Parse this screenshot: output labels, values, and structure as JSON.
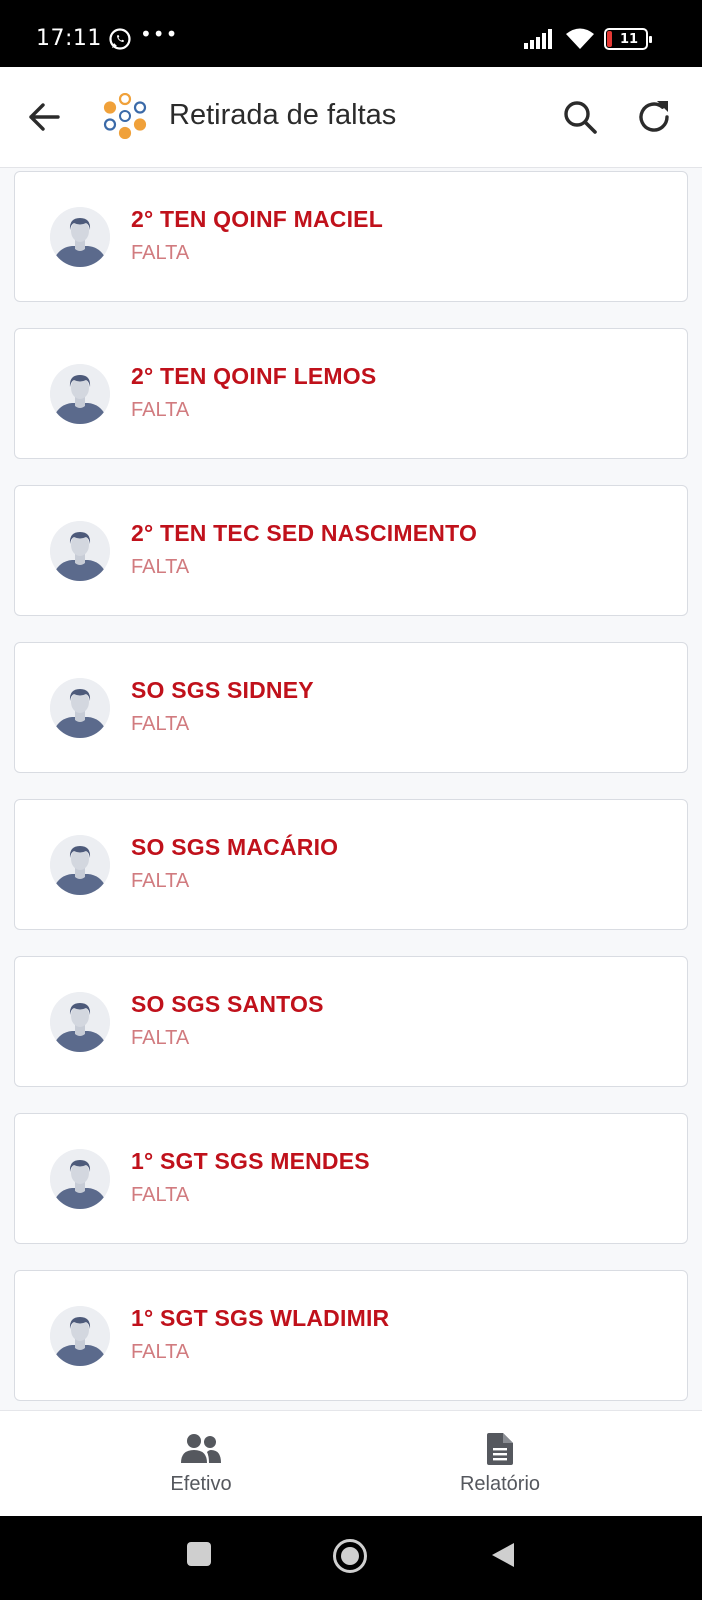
{
  "status_bar": {
    "time": "17:11",
    "more": "•••",
    "battery": "11"
  },
  "app_bar": {
    "title": "Retirada de faltas",
    "icons": [
      "back-arrow-icon",
      "app-logo-icon",
      "search-icon",
      "refresh-icon"
    ]
  },
  "list": {
    "items": [
      {
        "name": "2° TEN QOINF MACIEL",
        "status": "FALTA"
      },
      {
        "name": "2° TEN QOINF LEMOS",
        "status": "FALTA"
      },
      {
        "name": "2° TEN TEC SED NASCIMENTO",
        "status": "FALTA"
      },
      {
        "name": "SO SGS SIDNEY",
        "status": "FALTA"
      },
      {
        "name": "SO SGS MACÁRIO",
        "status": "FALTA"
      },
      {
        "name": "SO SGS SANTOS",
        "status": "FALTA"
      },
      {
        "name": "1° SGT SGS MENDES",
        "status": "FALTA"
      },
      {
        "name": "1° SGT SGS WLADIMIR",
        "status": "FALTA"
      }
    ]
  },
  "bottom_nav": {
    "efetivo": "Efetivo",
    "relatorio": "Relatório"
  },
  "colors": {
    "name_red": "#c0111b",
    "status_pink": "#d17b7f",
    "logo_orange": "#f0a13a",
    "logo_blue": "#3b6aa8"
  }
}
